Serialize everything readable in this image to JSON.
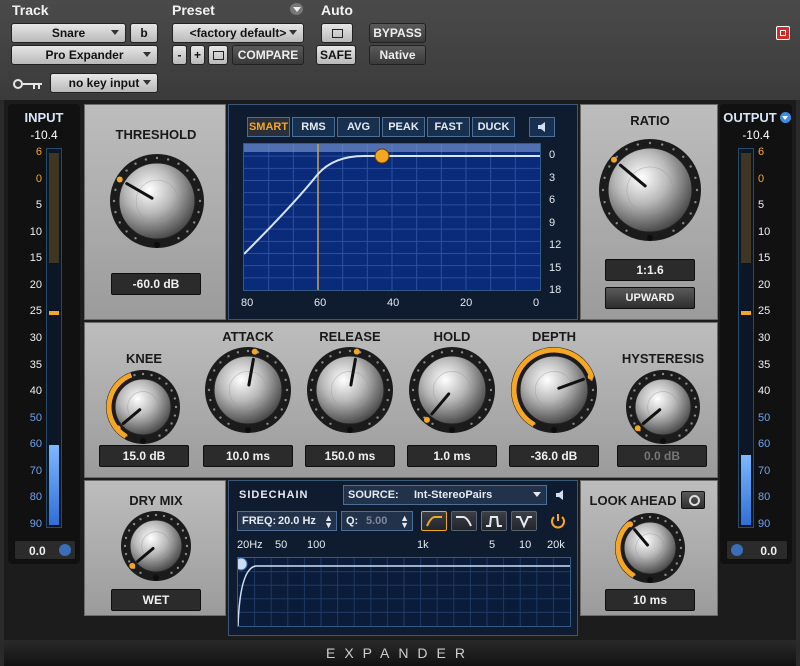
{
  "header": {
    "track_label": "Track",
    "preset_label": "Preset",
    "auto_label": "Auto",
    "track_name": "Snare",
    "track_channel": "b",
    "plugin_name": "Pro Expander",
    "preset_name": "<factory default>",
    "minus": "-",
    "plus": "+",
    "compare": "COMPARE",
    "safe": "SAFE",
    "bypass": "BYPASS",
    "native": "Native",
    "key_input": "no key input"
  },
  "input_meter": {
    "label": "INPUT",
    "peak": "-10.4",
    "value": "0.0",
    "scale": [
      "6",
      "0",
      "5",
      "10",
      "15",
      "20",
      "25",
      "30",
      "35",
      "40",
      "50",
      "60",
      "70",
      "80",
      "90"
    ]
  },
  "output_meter": {
    "label": "OUTPUT",
    "peak": "-10.4",
    "value": "0.0",
    "scale": [
      "6",
      "0",
      "5",
      "10",
      "15",
      "20",
      "25",
      "30",
      "35",
      "40",
      "50",
      "60",
      "70",
      "80",
      "90"
    ]
  },
  "threshold": {
    "label": "THRESHOLD",
    "value": "-60.0 dB"
  },
  "ratio": {
    "label": "RATIO",
    "value": "1:1.6",
    "mode": "UPWARD"
  },
  "graph": {
    "modes": [
      "SMART",
      "RMS",
      "AVG",
      "PEAK",
      "FAST",
      "DUCK"
    ],
    "active_mode": "SMART",
    "y_ticks": [
      "0",
      "3",
      "6",
      "9",
      "12",
      "15",
      "18"
    ],
    "x_ticks": [
      "80",
      "60",
      "40",
      "20",
      "0"
    ]
  },
  "knee": {
    "label": "KNEE",
    "value": "15.0 dB"
  },
  "attack": {
    "label": "ATTACK",
    "value": "10.0 ms"
  },
  "release": {
    "label": "RELEASE",
    "value": "150.0 ms"
  },
  "hold": {
    "label": "HOLD",
    "value": "1.0 ms"
  },
  "depth": {
    "label": "DEPTH",
    "value": "-36.0 dB"
  },
  "hysteresis": {
    "label": "HYSTERESIS",
    "value": "0.0 dB"
  },
  "dry_mix": {
    "label": "DRY MIX",
    "value": "WET"
  },
  "look_ahead": {
    "label": "LOOK AHEAD",
    "value": "10 ms"
  },
  "sidechain": {
    "label": "SIDECHAIN",
    "source_label": "SOURCE:",
    "source_value": "Int-StereoPairs",
    "freq_label": "FREQ:",
    "freq_value": "20.0 Hz",
    "q_label": "Q:",
    "q_value": "5.00",
    "freq_ticks": [
      "20Hz",
      "50",
      "100",
      "1k",
      "5",
      "10",
      "20k"
    ]
  },
  "plugin_title": "EXPANDER",
  "colors": {
    "accent_orange": "#f5a623",
    "meter_blue": "#3a8ee6",
    "graph_bg": "#0a1f5a"
  }
}
